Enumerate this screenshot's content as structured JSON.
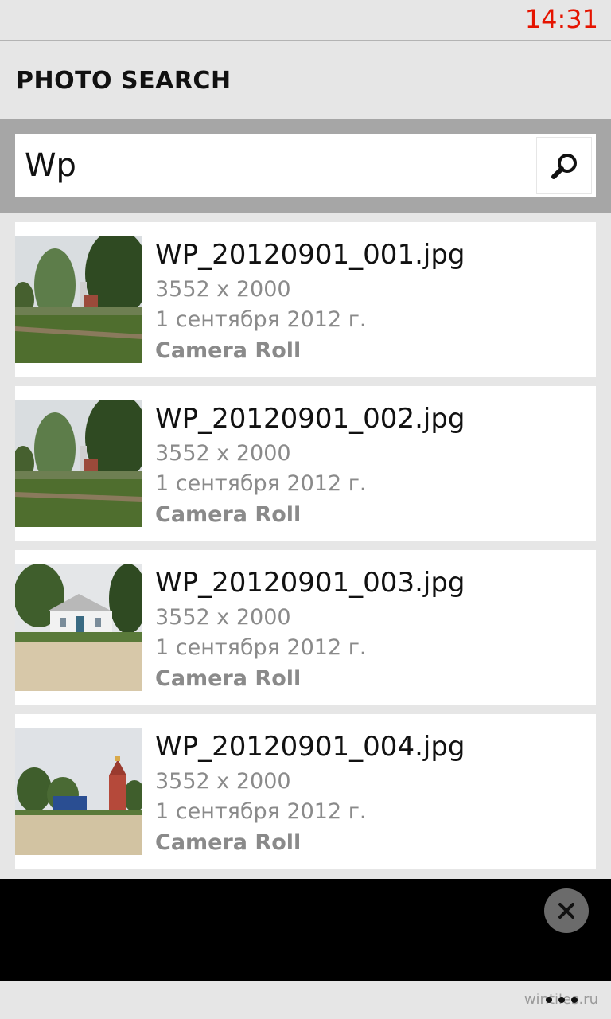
{
  "status_bar": {
    "time": "14:31"
  },
  "header": {
    "title": "PHOTO SEARCH"
  },
  "search": {
    "value": "Wp",
    "button_icon": "search-icon"
  },
  "results": [
    {
      "file_name": "WP_20120901_001.jpg",
      "dimensions": "3552 x 2000",
      "date": "1 сентября 2012 г.",
      "album": "Camera Roll"
    },
    {
      "file_name": "WP_20120901_002.jpg",
      "dimensions": "3552 x 2000",
      "date": "1 сентября 2012 г.",
      "album": "Camera Roll"
    },
    {
      "file_name": "WP_20120901_003.jpg",
      "dimensions": "3552 x 2000",
      "date": "1 сентября 2012 г.",
      "album": "Camera Roll"
    },
    {
      "file_name": "WP_20120901_004.jpg",
      "dimensions": "3552 x 2000",
      "date": "1 сентября 2012 г.",
      "album": "Camera Roll"
    }
  ],
  "overlay": {
    "close_icon": "close-icon"
  },
  "app_bar": {
    "more_icon": "more-icon",
    "watermark": "wintiles.ru"
  },
  "colors": {
    "accent": "#e51400",
    "background": "#e6e6e6",
    "search_band": "#a6a6a6",
    "secondary_text": "#8a8a8a"
  }
}
